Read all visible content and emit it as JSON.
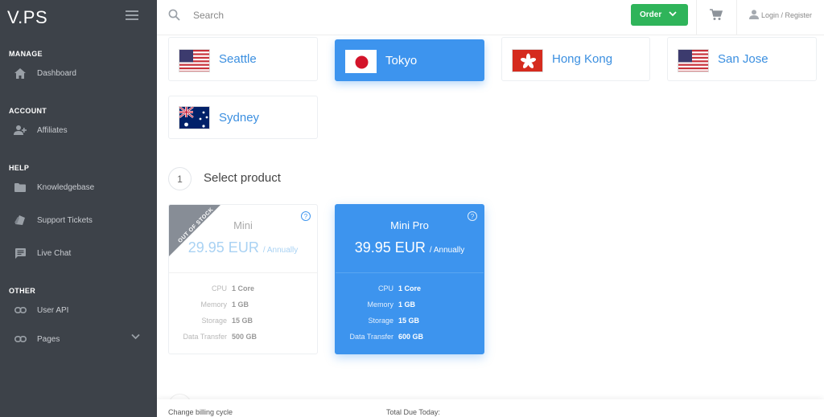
{
  "app": {
    "logo": "V.PS"
  },
  "sidebar": {
    "sections": [
      {
        "title": "MANAGE",
        "items": [
          {
            "label": "Dashboard",
            "icon": "home-icon"
          }
        ]
      },
      {
        "title": "ACCOUNT",
        "items": [
          {
            "label": "Affiliates",
            "icon": "user-plus-icon"
          }
        ]
      },
      {
        "title": "HELP",
        "items": [
          {
            "label": "Knowledgebase",
            "icon": "folder-icon"
          },
          {
            "label": "Support Tickets",
            "icon": "tickets-icon"
          },
          {
            "label": "Live Chat",
            "icon": "chat-icon"
          }
        ]
      },
      {
        "title": "OTHER",
        "items": [
          {
            "label": "User API",
            "icon": "link-icon"
          },
          {
            "label": "Pages",
            "icon": "link-icon"
          }
        ]
      }
    ]
  },
  "topbar": {
    "search_placeholder": "Search",
    "order_label": "Order",
    "login_label": "Login / Register"
  },
  "locations": [
    {
      "name": "Seattle",
      "flag": "us-flag",
      "active": false
    },
    {
      "name": "Tokyo",
      "flag": "jp-flag",
      "active": true
    },
    {
      "name": "Hong Kong",
      "flag": "hk-flag",
      "active": false
    },
    {
      "name": "San Jose",
      "flag": "us-flag",
      "active": false
    },
    {
      "name": "Sydney",
      "flag": "au-flag",
      "active": false
    }
  ],
  "step": {
    "number": "1",
    "title": "Select product"
  },
  "products": [
    {
      "name": "Mini",
      "price": "29.95 EUR",
      "period": "/ Annually",
      "ribbon": "OUT OF STOCK",
      "active": false,
      "help": "?",
      "specs": [
        {
          "key": "CPU",
          "value": "1 Core"
        },
        {
          "key": "Memory",
          "value": "1 GB"
        },
        {
          "key": "Storage",
          "value": "15 GB"
        },
        {
          "key": "Data Transfer",
          "value": "500 GB"
        }
      ]
    },
    {
      "name": "Mini Pro",
      "price": "39.95 EUR",
      "period": "/ Annually",
      "ribbon": "",
      "active": true,
      "help": "?",
      "specs": [
        {
          "key": "CPU",
          "value": "1 Core"
        },
        {
          "key": "Memory",
          "value": "1 GB"
        },
        {
          "key": "Storage",
          "value": "15 GB"
        },
        {
          "key": "Data Transfer",
          "value": "600 GB"
        }
      ]
    }
  ],
  "bottom": {
    "billing_label": "Change billing cycle",
    "total_label": "Total Due Today:"
  },
  "colors": {
    "accent": "#3d94ee",
    "order": "#2fb45a",
    "sidebar": "#3d4249"
  }
}
